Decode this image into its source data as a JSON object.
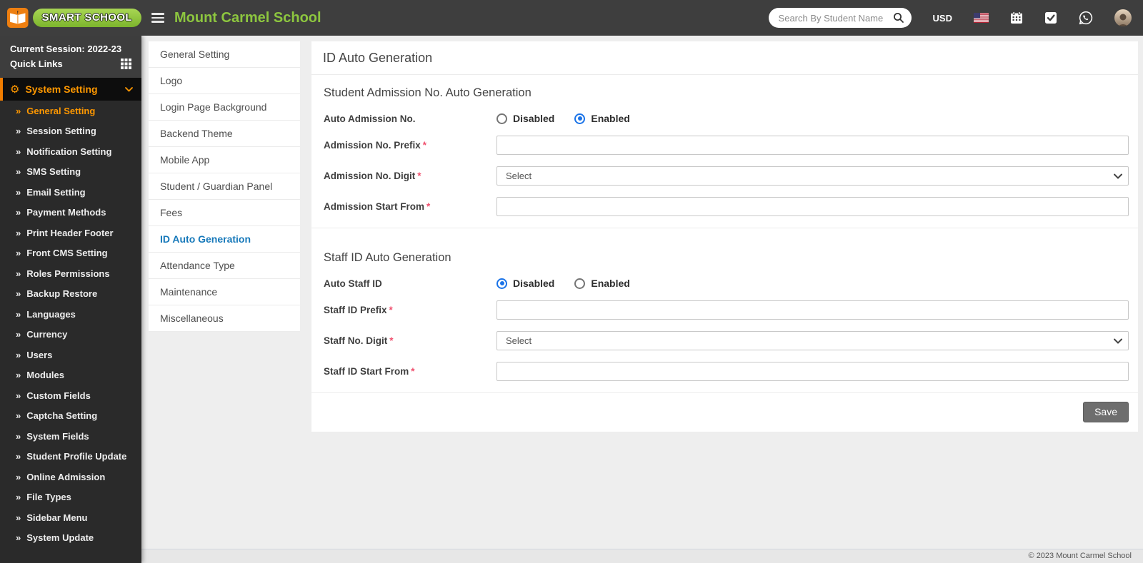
{
  "header": {
    "brand": "SMART SCHOOL",
    "school_name": "Mount Carmel School",
    "search_placeholder": "Search By Student Name",
    "currency": "USD"
  },
  "sidebar": {
    "session": "Current Session: 2022-23",
    "quick_links": "Quick Links",
    "section_label": "System Setting",
    "items": [
      {
        "label": "General Setting",
        "active": true
      },
      {
        "label": "Session Setting"
      },
      {
        "label": "Notification Setting"
      },
      {
        "label": "SMS Setting"
      },
      {
        "label": "Email Setting"
      },
      {
        "label": "Payment Methods"
      },
      {
        "label": "Print Header Footer"
      },
      {
        "label": "Front CMS Setting"
      },
      {
        "label": "Roles Permissions"
      },
      {
        "label": "Backup Restore"
      },
      {
        "label": "Languages"
      },
      {
        "label": "Currency"
      },
      {
        "label": "Users"
      },
      {
        "label": "Modules"
      },
      {
        "label": "Custom Fields"
      },
      {
        "label": "Captcha Setting"
      },
      {
        "label": "System Fields"
      },
      {
        "label": "Student Profile Update"
      },
      {
        "label": "Online Admission"
      },
      {
        "label": "File Types"
      },
      {
        "label": "Sidebar Menu"
      },
      {
        "label": "System Update"
      }
    ]
  },
  "subnav": {
    "items": [
      {
        "label": "General Setting"
      },
      {
        "label": "Logo"
      },
      {
        "label": "Login Page Background"
      },
      {
        "label": "Backend Theme"
      },
      {
        "label": "Mobile App"
      },
      {
        "label": "Student / Guardian Panel"
      },
      {
        "label": "Fees"
      },
      {
        "label": "ID Auto Generation",
        "active": true
      },
      {
        "label": "Attendance Type"
      },
      {
        "label": "Maintenance"
      },
      {
        "label": "Miscellaneous"
      }
    ]
  },
  "main": {
    "title": "ID Auto Generation",
    "student_section": {
      "heading": "Student Admission No. Auto Generation",
      "radio_label": "Auto Admission No.",
      "radio_options": [
        "Disabled",
        "Enabled"
      ],
      "radio_selected": "Enabled",
      "fields": [
        {
          "label": "Admission No. Prefix",
          "required": "*",
          "type": "text",
          "value": ""
        },
        {
          "label": "Admission No. Digit",
          "required": "*",
          "type": "select",
          "value": "Select"
        },
        {
          "label": "Admission Start From",
          "required": "*",
          "type": "text",
          "value": ""
        }
      ]
    },
    "staff_section": {
      "heading": "Staff ID Auto Generation",
      "radio_label": "Auto Staff ID",
      "radio_options": [
        "Disabled",
        "Enabled"
      ],
      "radio_selected": "Disabled",
      "fields": [
        {
          "label": "Staff ID Prefix",
          "required": "*",
          "type": "text",
          "value": ""
        },
        {
          "label": "Staff No. Digit",
          "required": "*",
          "type": "select",
          "value": "Select"
        },
        {
          "label": "Staff ID Start From",
          "required": "*",
          "type": "text",
          "value": ""
        }
      ]
    },
    "save_label": "Save"
  },
  "footer": {
    "copyright": "© 2023 Mount Carmel School"
  },
  "colors": {
    "accent_orange": "#ff9800",
    "brand_green": "#8dc63f",
    "active_link_blue": "#1779ba",
    "radio_blue": "#1a73e8",
    "header_bg": "#3e3e3e"
  }
}
